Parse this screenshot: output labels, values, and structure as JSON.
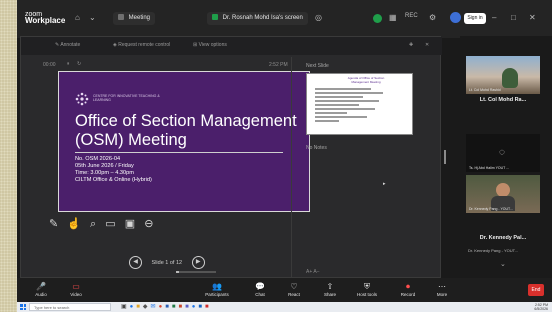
{
  "brand": {
    "line1": "zoom",
    "line2": "Workplace"
  },
  "topbar": {
    "tab_meeting": "Meeting",
    "tab_viewing": "Dr. Rosnah Mohd Isa's screen",
    "rec_label": "REC",
    "signin_label": "Sign in"
  },
  "share_toolbar": {
    "items": [
      "Annotate",
      "Request remote control",
      "View options"
    ]
  },
  "presenter": {
    "timer_left": "00:00",
    "timer_right": "2:52 PM",
    "next_slide_label": "Next Slide",
    "notes_label": "No Notes",
    "slide_counter": "Slide 1 of 12"
  },
  "slide": {
    "logo_text": "CENTRE FOR INNOVATIVE TEACHING & LEARNING",
    "title": "Office of Section Management (OSM) Meeting",
    "info": [
      "No. OSM 2026-04",
      "05th June 2026 / Friday",
      "Time: 3.00pm – 4.30pm",
      "CILTM Office & Online (Hybrid)"
    ]
  },
  "thumbnail": {
    "title": "Agenda of Office of Section Management Meeting"
  },
  "participants": [
    {
      "name": "Lt. Col Mohd Ra...",
      "overlay": "Lt. Col Mohd Rashid"
    },
    {
      "name": "",
      "overlay": "Ts. Hj Abd Halim YOUT ..."
    },
    {
      "name": "Dr. Kennedy Pal...",
      "overlay": "Dr. Kennedy Pang - YOUT..."
    }
  ],
  "controls": [
    {
      "icon": "mic-icon",
      "glyph": "🎤",
      "label": "Audio",
      "muted": true
    },
    {
      "icon": "video-icon",
      "glyph": "▭",
      "label": "Video",
      "muted": true
    },
    {
      "icon": "participants-icon",
      "glyph": "👥",
      "label": "Participants"
    },
    {
      "icon": "chat-icon",
      "glyph": "💬",
      "label": "Chat"
    },
    {
      "icon": "react-icon",
      "glyph": "♡",
      "label": "React"
    },
    {
      "icon": "share-icon",
      "glyph": "⇧",
      "label": "Share"
    },
    {
      "icon": "host-tools-icon",
      "glyph": "⛨",
      "label": "Host tools"
    },
    {
      "icon": "record-icon",
      "glyph": "⏺",
      "label": "Record"
    },
    {
      "icon": "more-icon",
      "glyph": "⋯",
      "label": "More"
    }
  ],
  "end_label": "End",
  "taskbar": {
    "search_placeholder": "Type here to search",
    "time": "2:52 PM",
    "date": "6/5/2026"
  },
  "colors": {
    "slide_bg": "#4b1f6b",
    "end_red": "#d9302c",
    "meeting_green": "#1f9e4a"
  }
}
